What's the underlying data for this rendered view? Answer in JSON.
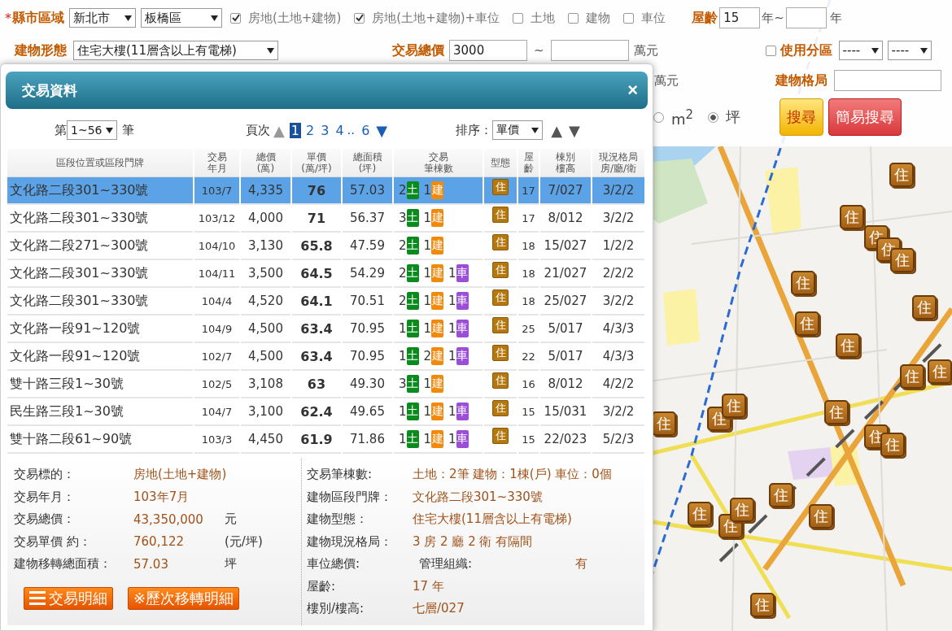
{
  "search_form": {
    "row1": {
      "required_mark": "*",
      "label": "縣市區域",
      "selects": [
        "新北市",
        "板橋區"
      ],
      "types": [
        {
          "label": "房地(土地+建物)",
          "checked": true
        },
        {
          "label": "房地(土地+建物)+車位",
          "checked": true
        },
        {
          "label": "土地",
          "checked": false
        },
        {
          "label": "建物",
          "checked": false
        },
        {
          "label": "車位",
          "checked": false
        }
      ],
      "age_label": "屋齡",
      "age_from": "15",
      "age_sep": "年~",
      "age_unit": "年"
    },
    "row2": {
      "label": "建物形態",
      "building_type": "住宅大樓(11層含以上有電梯)",
      "price_label": "交易總價",
      "price_from": "3000",
      "price_sep": "~",
      "price_unit": "萬元",
      "zoning": {
        "label": "使用分區",
        "checked": false
      },
      "zoning_selects": [
        "----",
        "----"
      ]
    },
    "row3": {
      "area_unit": "萬元",
      "layout_label": "建物格局"
    },
    "row4": {
      "units": [
        {
          "label": "m$^{2}$",
          "selected": false
        },
        {
          "label": "坪",
          "selected": true
        }
      ],
      "buttons": [
        {
          "label": "搜尋",
          "kind": "primary"
        },
        {
          "label": "簡易搜尋",
          "kind": "secondary"
        }
      ]
    }
  },
  "dialog": {
    "title": "交易資料",
    "close": "×",
    "pager": {
      "prefix": "第",
      "range": "1~56",
      "suffix": "筆",
      "page_label": "頁次",
      "prev": {
        "label": "▲",
        "disabled": true
      },
      "pages": [
        {
          "label": "1",
          "selected": true
        },
        {
          "label": "2",
          "selected": false
        },
        {
          "label": "3",
          "selected": false
        },
        {
          "label": "4",
          "selected": false
        }
      ],
      "ellipsis": "..",
      "last_page": {
        "label": "6",
        "selected": false
      },
      "next": {
        "label": "▼",
        "disabled": false
      }
    },
    "sort": {
      "label": "排序：",
      "value": "單價",
      "asc": "▲",
      "desc": "▼"
    },
    "table": {
      "columns": [
        [
          "區段位置或區段門牌"
        ],
        [
          "交易",
          "年月"
        ],
        [
          "總價",
          "(萬)"
        ],
        [
          "單價",
          "(萬/坪)"
        ],
        [
          "總面積",
          "(坪)"
        ],
        [
          "交易",
          "筆棟數"
        ],
        [
          "型態"
        ],
        [
          "屋",
          "齡"
        ],
        [
          "棟別",
          "樓高"
        ],
        [
          "現況格局",
          "房/廳/衛"
        ]
      ],
      "rows": [
        {
          "location": "文化路二段301~330號",
          "date": "103/7",
          "total": "4,335",
          "unit_price": "76",
          "area": "57.03",
          "counts": [
            {
              "kind": "land",
              "count": "2",
              "label": "土"
            },
            {
              "kind": "building",
              "count": "1",
              "label": "建"
            }
          ],
          "type": "住",
          "age": "17",
          "floor": "7/027",
          "layout": "3/2/2",
          "selected": true
        },
        {
          "location": "文化路二段301~330號",
          "date": "103/12",
          "total": "4,000",
          "unit_price": "71",
          "area": "56.37",
          "counts": [
            {
              "kind": "land",
              "count": "3",
              "label": "土"
            },
            {
              "kind": "building",
              "count": "1",
              "label": "建"
            }
          ],
          "type": "住",
          "age": "17",
          "floor": "8/012",
          "layout": "3/2/2",
          "selected": false
        },
        {
          "location": "文化路二段271~300號",
          "date": "104/10",
          "total": "3,130",
          "unit_price": "65.8",
          "area": "47.59",
          "counts": [
            {
              "kind": "land",
              "count": "2",
              "label": "土"
            },
            {
              "kind": "building",
              "count": "1",
              "label": "建"
            }
          ],
          "type": "住",
          "age": "18",
          "floor": "15/027",
          "layout": "1/2/2",
          "selected": false
        },
        {
          "location": "文化路二段301~330號",
          "date": "104/11",
          "total": "3,500",
          "unit_price": "64.5",
          "area": "54.29",
          "counts": [
            {
              "kind": "land",
              "count": "2",
              "label": "土"
            },
            {
              "kind": "building",
              "count": "1",
              "label": "建"
            },
            {
              "kind": "parking",
              "count": "1",
              "label": "車"
            }
          ],
          "type": "住",
          "age": "18",
          "floor": "21/027",
          "layout": "2/2/2",
          "selected": false
        },
        {
          "location": "文化路二段301~330號",
          "date": "104/4",
          "total": "4,520",
          "unit_price": "64.1",
          "area": "70.51",
          "counts": [
            {
              "kind": "land",
              "count": "2",
              "label": "土"
            },
            {
              "kind": "building",
              "count": "1",
              "label": "建"
            },
            {
              "kind": "parking",
              "count": "1",
              "label": "車"
            }
          ],
          "type": "住",
          "age": "18",
          "floor": "25/027",
          "layout": "3/2/2",
          "selected": false
        },
        {
          "location": "文化路一段91~120號",
          "date": "104/9",
          "total": "4,500",
          "unit_price": "63.4",
          "area": "70.95",
          "counts": [
            {
              "kind": "land",
              "count": "1",
              "label": "土"
            },
            {
              "kind": "building",
              "count": "1",
              "label": "建"
            },
            {
              "kind": "parking",
              "count": "1",
              "label": "車"
            }
          ],
          "type": "住",
          "age": "25",
          "floor": "5/017",
          "layout": "4/3/3",
          "selected": false
        },
        {
          "location": "文化路一段91~120號",
          "date": "102/7",
          "total": "4,500",
          "unit_price": "63.4",
          "area": "70.95",
          "counts": [
            {
              "kind": "land",
              "count": "1",
              "label": "土"
            },
            {
              "kind": "building",
              "count": "2",
              "label": "建"
            },
            {
              "kind": "parking",
              "count": "1",
              "label": "車"
            }
          ],
          "type": "住",
          "age": "22",
          "floor": "5/017",
          "layout": "4/3/3",
          "selected": false
        },
        {
          "location": "雙十路三段1~30號",
          "date": "102/5",
          "total": "3,108",
          "unit_price": "63",
          "area": "49.30",
          "counts": [
            {
              "kind": "land",
              "count": "3",
              "label": "土"
            },
            {
              "kind": "building",
              "count": "1",
              "label": "建"
            }
          ],
          "type": "住",
          "age": "16",
          "floor": "8/012",
          "layout": "4/2/2",
          "selected": false
        },
        {
          "location": "民生路三段1~30號",
          "date": "104/7",
          "total": "3,100",
          "unit_price": "62.4",
          "area": "49.65",
          "counts": [
            {
              "kind": "land",
              "count": "1",
              "label": "土"
            },
            {
              "kind": "building",
              "count": "1",
              "label": "建"
            },
            {
              "kind": "parking",
              "count": "1",
              "label": "車"
            }
          ],
          "type": "住",
          "age": "15",
          "floor": "15/031",
          "layout": "3/2/2",
          "selected": false
        },
        {
          "location": "雙十路二段61~90號",
          "date": "103/3",
          "total": "4,450",
          "unit_price": "61.9",
          "area": "71.86",
          "counts": [
            {
              "kind": "land",
              "count": "1",
              "label": "土"
            },
            {
              "kind": "building",
              "count": "1",
              "label": "建"
            },
            {
              "kind": "parking",
              "count": "1",
              "label": "車"
            }
          ],
          "type": "住",
          "age": "15",
          "floor": "22/023",
          "layout": "5/2/3",
          "selected": false
        }
      ]
    },
    "details": {
      "left": [
        {
          "label": "交易標的：",
          "value": "房地(土地+建物)"
        },
        {
          "label": "交易年月：",
          "value": "103年7月"
        },
        {
          "label": "交易總價：",
          "value": "43,350,000",
          "unit": "元"
        },
        {
          "label": "交易單價 約：",
          "value": "760,122",
          "unit": "(元/坪)"
        },
        {
          "label": "建物移轉總面積：",
          "value": "57.03",
          "unit": "坪"
        }
      ],
      "buttons": [
        {
          "kind": "list",
          "label": "交易明細"
        },
        {
          "kind": "plain",
          "label": "※歷次移轉明細"
        }
      ],
      "right": [
        {
          "label": "交易筆棟數:",
          "value": "土地：2筆 建物：1棟(戶) 車位：0個"
        },
        {
          "label": "建物區段門牌：",
          "value": "文化路二段301~330號"
        },
        {
          "label": "建物型態：",
          "value": "住宅大樓(11層含以上有電梯)"
        },
        {
          "label": "建物現況格局：",
          "value": "3 房 2 廳 2 衛 有隔間"
        },
        {
          "label": "車位總價:",
          "extra_label": "管理組織:",
          "value": "有"
        },
        {
          "label": "屋齡:",
          "value": "17  年"
        },
        {
          "label": "樓別/樓高:",
          "value": "七層/027"
        }
      ]
    }
  },
  "map": {
    "markers": [
      {
        "label": "住"
      },
      {
        "label": "住"
      },
      {
        "label": "住"
      },
      {
        "label": "住"
      },
      {
        "label": "住"
      },
      {
        "label": "住"
      },
      {
        "label": "住"
      },
      {
        "label": "住"
      },
      {
        "label": "住"
      },
      {
        "label": "住"
      },
      {
        "label": "住"
      },
      {
        "label": "住"
      },
      {
        "label": "住"
      },
      {
        "label": "住"
      },
      {
        "label": "住"
      },
      {
        "label": "住"
      },
      {
        "label": "住"
      },
      {
        "label": "住"
      },
      {
        "label": "住"
      },
      {
        "label": "住"
      },
      {
        "label": "住"
      },
      {
        "label": "住"
      },
      {
        "label": "住"
      }
    ]
  }
}
